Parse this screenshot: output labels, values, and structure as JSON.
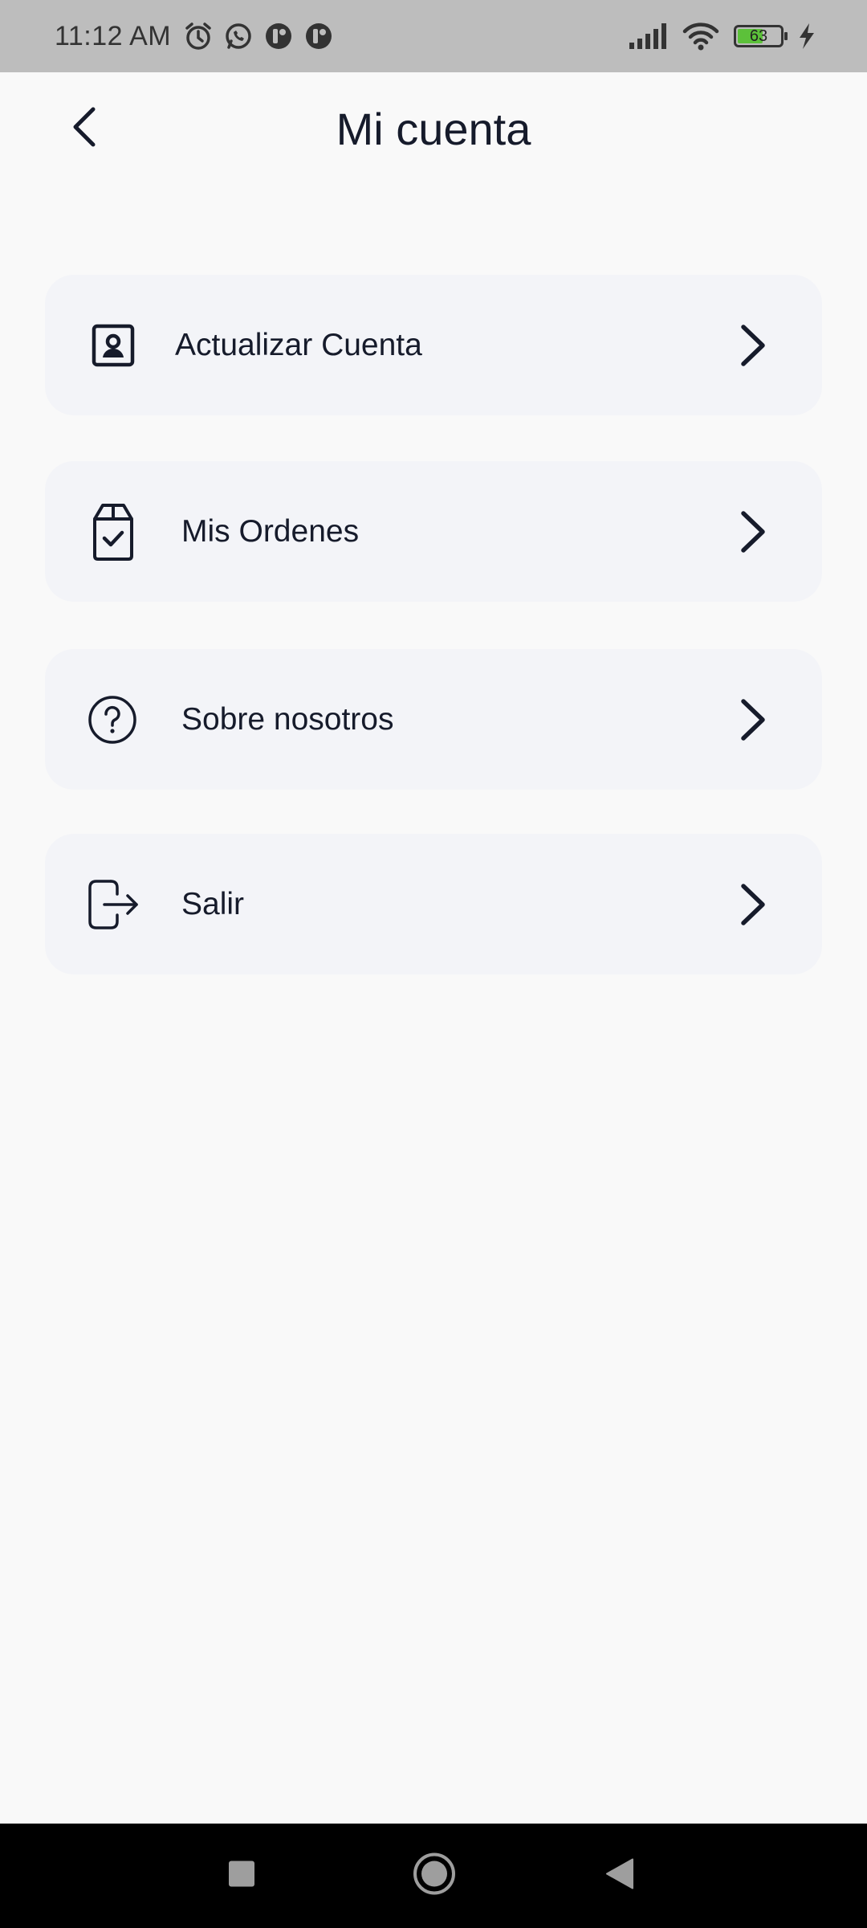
{
  "status_bar": {
    "time": "11:12 AM",
    "notification_icons": [
      "alarm-icon",
      "whatsapp-icon",
      "app-icon",
      "app-icon"
    ],
    "battery_level": "63",
    "right_icons": [
      "signal-icon",
      "wifi-icon",
      "battery-icon",
      "charging-icon"
    ]
  },
  "header": {
    "title": "Mi cuenta",
    "back_icon": "chevron-left-icon"
  },
  "menu": {
    "items": [
      {
        "label": "Actualizar Cuenta",
        "icon": "account-card-icon"
      },
      {
        "label": "Mis Ordenes",
        "icon": "order-box-check-icon"
      },
      {
        "label": "Sobre nosotros",
        "icon": "help-circle-icon"
      },
      {
        "label": "Salir",
        "icon": "logout-icon"
      }
    ],
    "chevron_icon": "chevron-right-icon"
  },
  "nav_bar": {
    "buttons": [
      "recents-button",
      "home-button",
      "back-button"
    ]
  },
  "colors": {
    "background": "#f9f9f9",
    "card": "#f3f4f8",
    "text": "#161b2b",
    "status_bar": "#bdbdbd",
    "battery_fill": "#5cc13a"
  }
}
